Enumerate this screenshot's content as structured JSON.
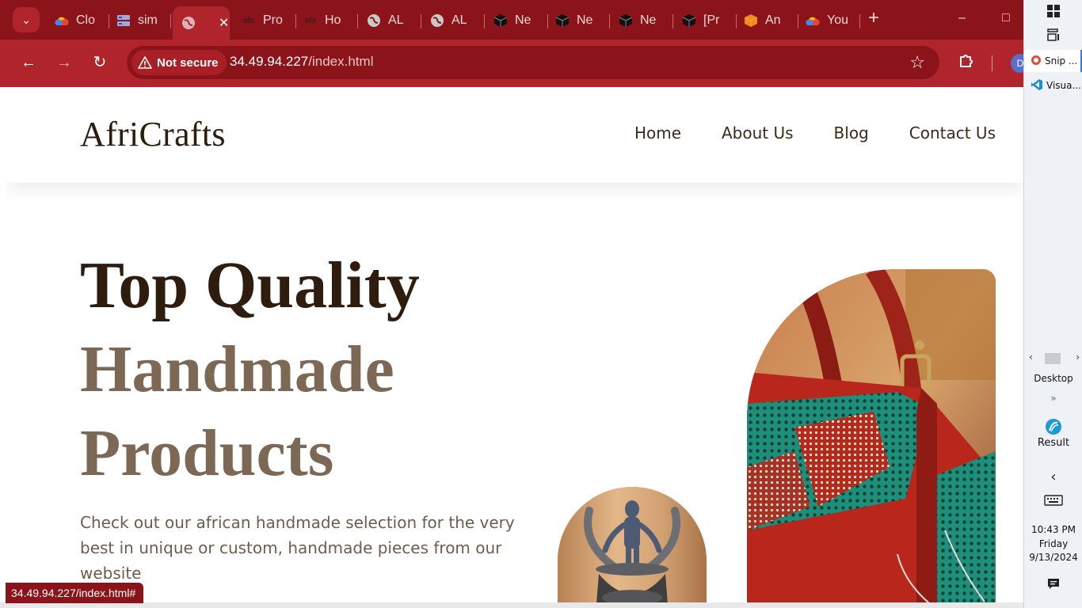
{
  "browser": {
    "tabs": [
      {
        "label": "Clo",
        "icon": "cloud-icon"
      },
      {
        "label": "sim",
        "icon": "server-icon"
      },
      {
        "label": "",
        "icon": "globe-icon",
        "active": true
      },
      {
        "label": "Pro",
        "icon": "olx-icon"
      },
      {
        "label": "Ho",
        "icon": "olx-icon"
      },
      {
        "label": "AL",
        "icon": "globe-icon"
      },
      {
        "label": "AL",
        "icon": "globe-icon"
      },
      {
        "label": "Ne",
        "icon": "cube-icon"
      },
      {
        "label": "Ne",
        "icon": "cube-icon"
      },
      {
        "label": "Ne",
        "icon": "cube-icon"
      },
      {
        "label": "[Pr",
        "icon": "cube-icon"
      },
      {
        "label": "An",
        "icon": "orange-cube-icon"
      },
      {
        "label": "You",
        "icon": "cloud-icon"
      }
    ],
    "address": {
      "security_label": "Not secure",
      "host": "34.49.94.227",
      "path": "/index.html"
    },
    "profile_initial": "D",
    "status_url": "34.49.94.227/index.html#",
    "accent_color": "#b0252b"
  },
  "site": {
    "logo": "AfriCrafts",
    "nav": [
      "Home",
      "About Us",
      "Blog",
      "Contact Us"
    ],
    "hero": {
      "title_line1": "Top Quality",
      "title_line2": "Handmade",
      "title_line3": "Products",
      "description": "Check out our african handmade selection for the very best in unique or custom, handmade pieces from our website"
    }
  },
  "taskbar": {
    "apps": [
      {
        "label": "Snip ...",
        "icon": "snipping-tool-icon",
        "active": true
      },
      {
        "label": "Visua...",
        "icon": "vscode-icon",
        "active": false
      }
    ],
    "desktop_label": "Desktop",
    "chevrons": "»",
    "result_label": "Result",
    "time": "10:43 PM",
    "day": "Friday",
    "date": "9/13/2024"
  }
}
